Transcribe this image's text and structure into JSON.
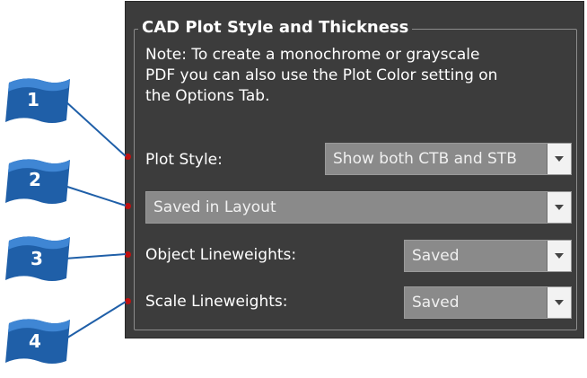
{
  "group": {
    "title": "CAD Plot Style and Thickness",
    "note": "Note:  To create a monochrome or grayscale\nPDF  you can also use the Plot Color setting on\nthe Options Tab."
  },
  "plot_style": {
    "label": "Plot Style:",
    "value": "Show both CTB and STB"
  },
  "layout_combo": {
    "value": "Saved in Layout"
  },
  "object_lineweights": {
    "label": "Object Lineweights:",
    "value": "Saved"
  },
  "scale_lineweights": {
    "label": "Scale Lineweights:",
    "value": "Saved"
  },
  "callouts": [
    "1",
    "2",
    "3",
    "4"
  ],
  "colors": {
    "panel_bg": "#3c3c3c",
    "combo_bg": "#8a8a8a",
    "callout_blue": "#1f5fa8",
    "callout_dot": "#c01010"
  },
  "icons": {
    "dropdown": "chevron-down-icon",
    "callout": "flag-icon"
  }
}
